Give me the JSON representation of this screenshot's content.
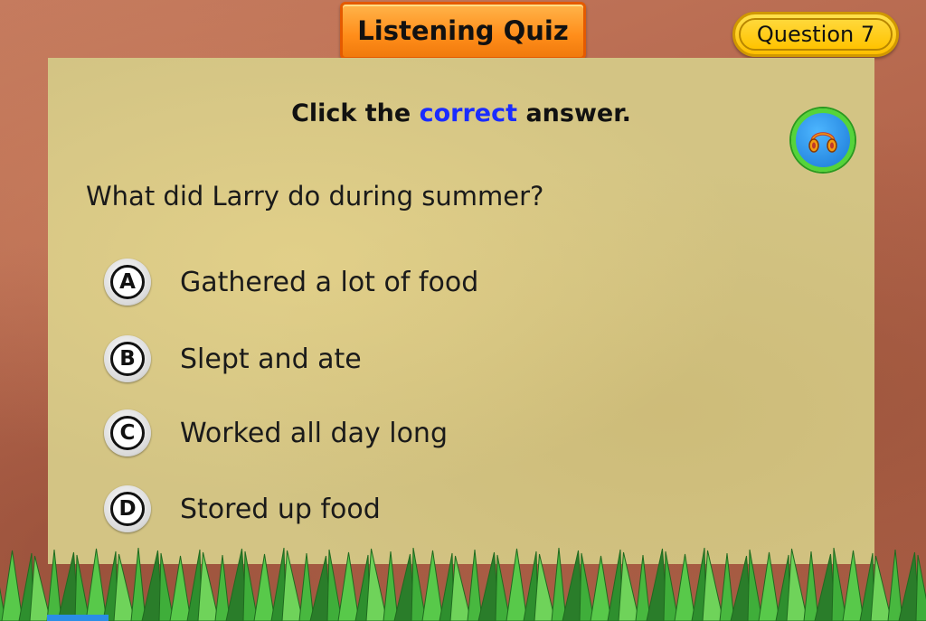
{
  "header": {
    "title": "Listening Quiz",
    "question_label": "Question 7"
  },
  "prompt": {
    "instruction_before": "Click the",
    "instruction_highlight": "correct",
    "instruction_after": "answer.",
    "question": "What did Larry do during summer?"
  },
  "audio_button": {
    "icon": "headphones-icon"
  },
  "options": [
    {
      "letter": "A",
      "text": "Gathered a lot of food"
    },
    {
      "letter": "B",
      "text": "Slept and ate"
    },
    {
      "letter": "C",
      "text": "Worked all day long"
    },
    {
      "letter": "D",
      "text": "Stored up food"
    }
  ],
  "colors": {
    "accent_title": "#ff8d1a",
    "badge": "#ffc300",
    "highlight_text": "#1a2cff",
    "audio_ring": "#55d43a",
    "audio_fill": "#1a78d6"
  }
}
